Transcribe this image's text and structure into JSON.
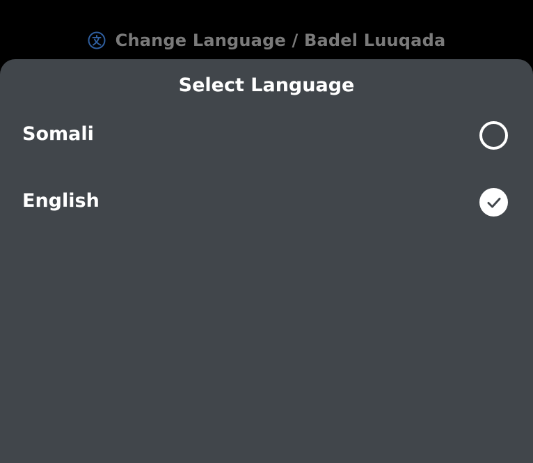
{
  "header": {
    "title": "Change Language / Badel Luuqada",
    "icon": "translate-icon",
    "icon_color": "#2f5fa0"
  },
  "sheet": {
    "title": "Select Language",
    "background": "#41464b"
  },
  "options": [
    {
      "label": "Somali",
      "selected": false
    },
    {
      "label": "English",
      "selected": true
    }
  ]
}
